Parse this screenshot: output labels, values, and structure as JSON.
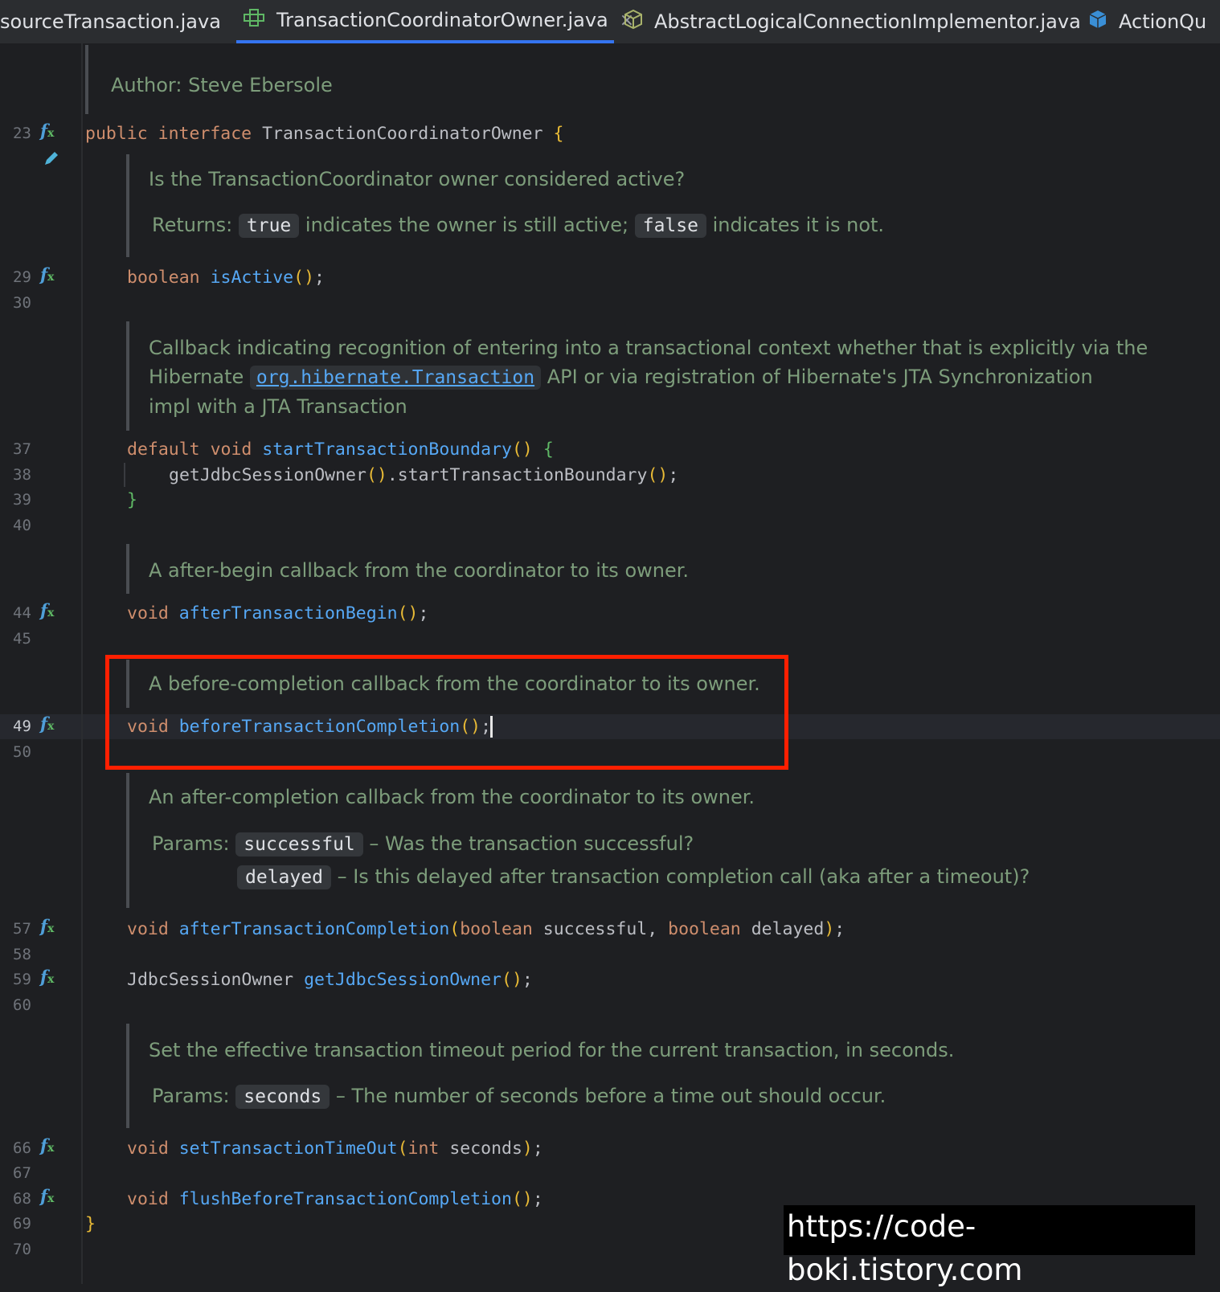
{
  "tabs": [
    {
      "label": "sourceTransaction.java",
      "active": false
    },
    {
      "label": "TransactionCoordinatorOwner.java",
      "active": true
    },
    {
      "label": "AbstractLogicalConnectionImplementor.java",
      "active": false
    },
    {
      "label": "ActionQu",
      "active": false
    }
  ],
  "tab_close": "×",
  "gutter": {
    "lines": [
      "23",
      "29",
      "30",
      "37",
      "38",
      "39",
      "40",
      "44",
      "45",
      "49",
      "50",
      "57",
      "58",
      "59",
      "60",
      "66",
      "67",
      "68",
      "69",
      "70"
    ],
    "fx_symbol": "f"
  },
  "code": {
    "author_label": "Author:",
    "author_name": "Steve Ebersole",
    "l23_kw1": "public",
    "l23_kw2": "interface",
    "l23_name": "TransactionCoordinatorOwner",
    "l23_brace": "{",
    "doc_isActive": "Is the TransactionCoordinator owner considered active?",
    "doc_returns_label": "Returns:",
    "doc_true": "true",
    "doc_true_text": "indicates the owner is still active;",
    "doc_false": "false",
    "doc_false_text": "indicates it is not.",
    "l29_kw": "boolean",
    "l29_fn": "isActive",
    "paren": "()",
    "semi": ";",
    "doc_start_l1": "Callback indicating recognition of entering into a transactional context whether that is explicitly via the",
    "doc_start_l2a": "Hibernate",
    "doc_start_link": "org.hibernate.Transaction",
    "doc_start_l2b": "API or via registration of Hibernate's JTA Synchronization",
    "doc_start_l3": "impl with a JTA Transaction",
    "l37_kw1": "default",
    "l37_kw2": "void",
    "l37_fn": "startTransactionBoundary",
    "l37_brace": "{",
    "l38_a": "getJdbcSessionOwner",
    "l38_b": ".startTransactionBoundary",
    "l39": "}",
    "doc_afterBegin": "A after-begin callback from the coordinator to its owner.",
    "kw_void": "void",
    "l44_fn": "afterTransactionBegin",
    "doc_beforeCompletion": "A before-completion callback from the coordinator to its owner.",
    "l49_fn": "beforeTransactionCompletion",
    "doc_afterCompletion": "An after-completion callback from the coordinator to its owner.",
    "doc_params_label": "Params:",
    "doc_p_successful": "successful",
    "doc_p_successful_text": "– Was the transaction successful?",
    "doc_p_delayed": "delayed",
    "doc_p_delayed_text": "– Is this delayed after transaction completion call (aka after a timeout)?",
    "l57_fn": "afterTransactionCompletion",
    "l57_open": "(",
    "kw_boolean": "boolean",
    "l57_p1": "successful,",
    "l57_p2": "delayed",
    "l57_close": ")",
    "l59_type": "JdbcSessionOwner",
    "l59_fn": "getJdbcSessionOwner",
    "doc_timeout": "Set the effective transaction timeout period for the current transaction, in seconds.",
    "doc_p_seconds": "seconds",
    "doc_p_seconds_text": "– The number of seconds before a time out should occur.",
    "l66_fn": "setTransactionTimeOut",
    "kw_int": "int",
    "l66_p": "seconds",
    "l68_fn": "flushBeforeTransactionCompletion",
    "l69": "}"
  },
  "watermark": "https://code-boki.tistory.com",
  "colors": {
    "background": "#1e1f22",
    "keyword": "#cf8e6d",
    "function": "#56a8f5",
    "paren": "#e8ba36",
    "doc": "#7d9d7b",
    "highlight_box": "#ff1f00",
    "tab_accent": "#3574f0"
  }
}
